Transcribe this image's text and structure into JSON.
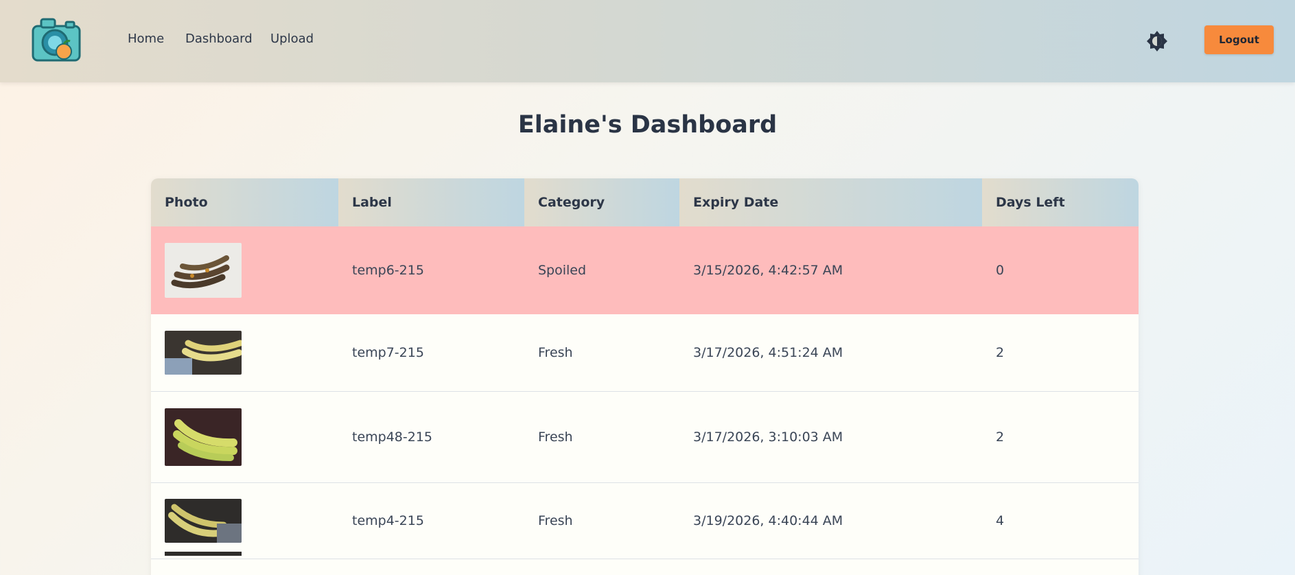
{
  "nav": {
    "links": [
      "Home",
      "Dashboard",
      "Upload"
    ],
    "logout_label": "Logout",
    "theme_icon": "sun-icon"
  },
  "page": {
    "title": "Elaine's Dashboard"
  },
  "table": {
    "headers": [
      "Photo",
      "Label",
      "Category",
      "Expiry Date",
      "Days Left"
    ],
    "rows": [
      {
        "label": "temp6-215",
        "category": "Spoiled",
        "expiry": "3/15/2026, 4:42:57 AM",
        "days_left": "0",
        "photo": "banana-photo"
      },
      {
        "label": "temp7-215",
        "category": "Fresh",
        "expiry": "3/17/2026, 4:51:24 AM",
        "days_left": "2",
        "photo": "banana-photo"
      },
      {
        "label": "temp48-215",
        "category": "Fresh",
        "expiry": "3/17/2026, 3:10:03 AM",
        "days_left": "2",
        "photo": "banana-photo"
      },
      {
        "label": "temp4-215",
        "category": "Fresh",
        "expiry": "3/19/2026, 4:40:44 AM",
        "days_left": "4",
        "photo": "banana-photo"
      }
    ]
  },
  "colors": {
    "accent": "#f78a3c",
    "spoiled_row": "#febcbc",
    "text": "#2d3748"
  }
}
